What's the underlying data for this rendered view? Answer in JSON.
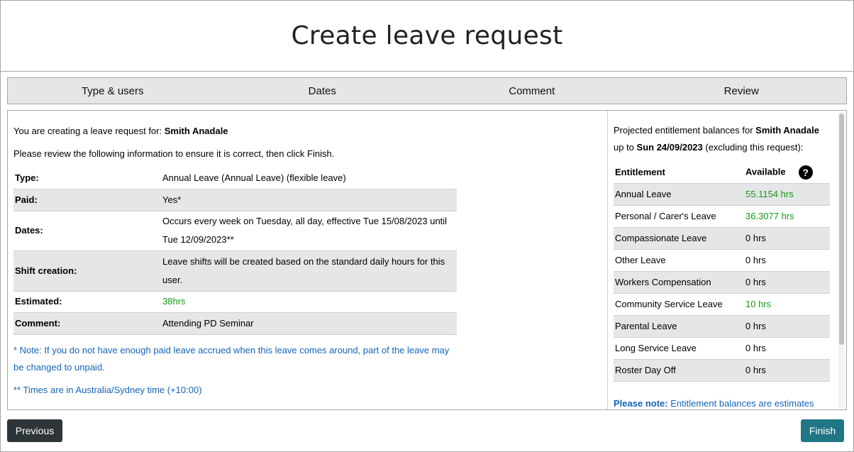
{
  "header": {
    "title": "Create leave request"
  },
  "steps": [
    "Type & users",
    "Dates",
    "Comment",
    "Review"
  ],
  "review": {
    "creating_prefix": "You are creating a leave request for: ",
    "user_name": "Smith Anadale",
    "instruction": "Please review the following information to ensure it is correct, then click Finish.",
    "rows": [
      {
        "label": "Type:",
        "value": "Annual Leave (Annual Leave) (flexible leave)"
      },
      {
        "label": "Paid:",
        "value": "Yes*"
      },
      {
        "label": "Dates:",
        "value_line1": "Occurs every week on Tuesday, all day, effective Tue 15/08/2023 until",
        "value_line2": "Tue 12/09/2023**"
      },
      {
        "label": "Shift creation:",
        "value_line1": "Leave shifts will be created based on the standard daily hours for this",
        "value_line2": "user."
      },
      {
        "label": "Estimated:",
        "value": "38hrs"
      },
      {
        "label": "Comment:",
        "value": "Attending PD Seminar"
      }
    ],
    "note1_line1": "* Note: If you do not have enough paid leave accrued when this leave comes around, part of the leave may",
    "note1_line2": "be changed to unpaid.",
    "note2": "** Times are in Australia/Sydney time (+10:00)"
  },
  "entitlements": {
    "intro_prefix": "Projected entitlement balances for ",
    "user_name": "Smith Anadale",
    "upto_prefix": "up to ",
    "upto_date": "Sun 24/09/2023",
    "upto_suffix": " (excluding this request):",
    "col_entitlement": "Entitlement",
    "col_available": "Available",
    "help_glyph": "?",
    "rows": [
      {
        "name": "Annual Leave",
        "available": "55.1154 hrs",
        "highlight": true
      },
      {
        "name": "Personal / Carer's Leave",
        "available": "36.3077 hrs",
        "highlight": true
      },
      {
        "name": "Compassionate Leave",
        "available": "0 hrs",
        "highlight": false
      },
      {
        "name": "Other Leave",
        "available": "0 hrs",
        "highlight": false
      },
      {
        "name": "Workers Compensation",
        "available": "0 hrs",
        "highlight": false
      },
      {
        "name": "Community Service Leave",
        "available": "10 hrs",
        "highlight": true
      },
      {
        "name": "Parental Leave",
        "available": "0 hrs",
        "highlight": false
      },
      {
        "name": "Long Service Leave",
        "available": "0 hrs",
        "highlight": false
      },
      {
        "name": "Roster Day Off",
        "available": "0 hrs",
        "highlight": false
      }
    ],
    "please_note_label": "Please note:",
    "please_note_text": " Entitlement balances are estimates"
  },
  "buttons": {
    "previous": "Previous",
    "finish": "Finish"
  },
  "colors": {
    "positive": "#179a17",
    "note": "#1565b8",
    "finish_bg": "#217686",
    "previous_bg": "#2d3538"
  }
}
